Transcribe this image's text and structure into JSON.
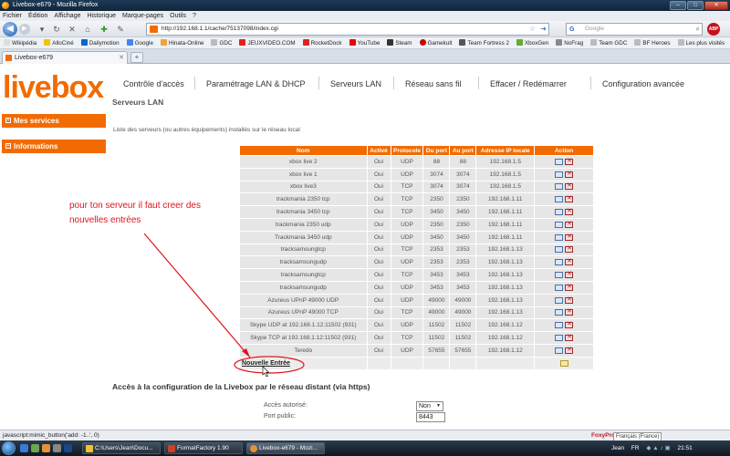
{
  "window": {
    "title": "Livebox-e679 - Mozilla Firefox"
  },
  "menu": [
    "Fichier",
    "Édition",
    "Affichage",
    "Historique",
    "Marque-pages",
    "Outils",
    "?"
  ],
  "url": "http://192.168.1.1/cache/75137098/index.cgi",
  "search_placeholder": "Google",
  "bookmarks": [
    "Wikipédia",
    "AlloCiné",
    "Dailymotion",
    "Google",
    "Hinata-Online",
    "GDC",
    "JEUXVIDEO.COM",
    "RocketDock",
    "YouTube",
    "Steam",
    "Gamekult",
    "Team Fortress 2",
    "XboxGen",
    "NoFrag",
    "Team GDC",
    "BF Heroes",
    "Les plus visités"
  ],
  "tab": {
    "title": "Livebox-e679"
  },
  "page": {
    "logo": "livebox",
    "nav": [
      "Contrôle d'accès",
      "Paramétrage LAN & DHCP",
      "Serveurs LAN",
      "Réseau sans fil",
      "Effacer / Redémarrer",
      "Configuration avancée"
    ],
    "side": [
      "Mes services",
      "Informations"
    ],
    "section_title": "Serveurs LAN",
    "intro": "Liste des serveurs (ou autres équipements) installés sur le réseau local",
    "table": {
      "headers": [
        "Nom",
        "Activé",
        "Protocole",
        "Du port",
        "Au port",
        "Adresse IP locale",
        "Action"
      ],
      "rows": [
        [
          "xbox live 2",
          "Oui",
          "UDP",
          "88",
          "88",
          "192.168.1.5"
        ],
        [
          "xbox live 1",
          "Oui",
          "UDP",
          "3074",
          "3074",
          "192.168.1.5"
        ],
        [
          "xbox live3",
          "Oui",
          "TCP",
          "3074",
          "3074",
          "192.168.1.5"
        ],
        [
          "trackmania 2350 tcp",
          "Oui",
          "TCP",
          "2350",
          "2350",
          "192.168.1.11"
        ],
        [
          "trackmania 3450 tcp",
          "Oui",
          "TCP",
          "3450",
          "3450",
          "192.168.1.11"
        ],
        [
          "trackmania 2350 udp",
          "Oui",
          "UDP",
          "2350",
          "2350",
          "192.168.1.11"
        ],
        [
          "Trackmania 3450 udp",
          "Oui",
          "UDP",
          "3450",
          "3450",
          "192.168.1.11"
        ],
        [
          "tracksamsungtcp",
          "Oui",
          "TCP",
          "2353",
          "2353",
          "192.168.1.13"
        ],
        [
          "tracksamsungudp",
          "Oui",
          "UDP",
          "2353",
          "2353",
          "192.168.1.13"
        ],
        [
          "tracksamsungtcp",
          "Oui",
          "TCP",
          "3453",
          "3453",
          "192.168.1.13"
        ],
        [
          "tracksamsungudp",
          "Oui",
          "UDP",
          "3453",
          "3453",
          "192.168.1.13"
        ],
        [
          "Azureus UPnP 49000 UDP",
          "Oui",
          "UDP",
          "49000",
          "49000",
          "192.168.1.13"
        ],
        [
          "Azureus UPnP 49000 TCP",
          "Oui",
          "TCP",
          "49000",
          "49000",
          "192.168.1.13"
        ],
        [
          "Skype UDP at 192.168.1.12:11502 (931)",
          "Oui",
          "UDP",
          "11502",
          "11502",
          "192.168.1.12"
        ],
        [
          "Skype TCP at 192.168.1.12:11502 (931)",
          "Oui",
          "TCP",
          "11502",
          "11502",
          "192.168.1.12"
        ],
        [
          "Teredo",
          "Oui",
          "UDP",
          "57655",
          "57655",
          "192.168.1.12"
        ]
      ],
      "new_entry": "Nouvelle Entrée"
    },
    "annotation": "pour ton serveur il faut creer des nouvelles entrées",
    "access": {
      "title": "Accès à la configuration de la Livebox par le réseau distant (via https)",
      "allowed_label": "Accès autorisé:",
      "allowed_value": "Non",
      "port_label": "Port public:",
      "port_value": "8443"
    }
  },
  "status": {
    "text": "javascript:mimic_button('add: -1..', 0)",
    "foxy": "FoxyProx",
    "lang_tip": "Français (France)"
  },
  "taskbar": {
    "tasks": [
      "C:\\Users\\Jean\\Docu...",
      "FormatFactory 1.90",
      "Livebox-e679 - Mozi...",
      "Jean",
      "FR",
      "21:51"
    ]
  },
  "colors": {
    "accent": "#f26b00",
    "annotation": "#e0141c"
  }
}
